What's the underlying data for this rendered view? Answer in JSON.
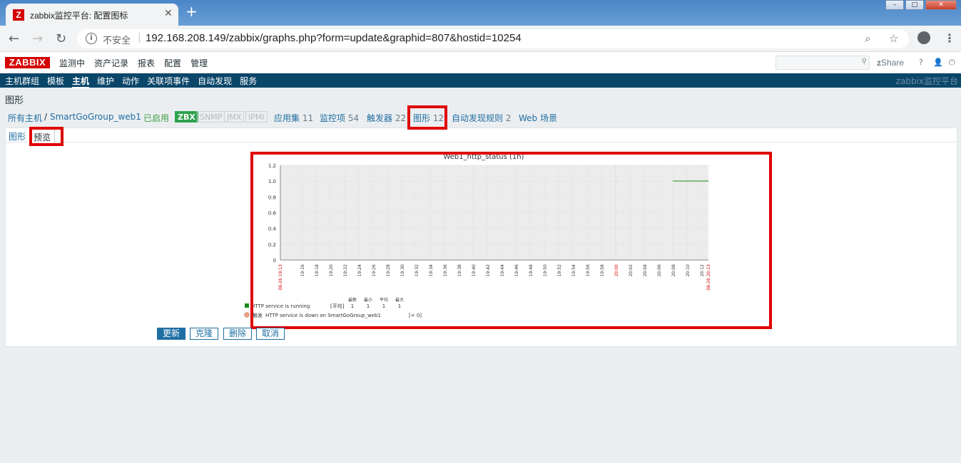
{
  "browser": {
    "tab_title": "zabbix监控平台: 配置图标",
    "tab_favicon": "Z",
    "security_label": "不安全",
    "url": "192.168.208.149/zabbix/graphs.php?form=update&graphid=807&hostid=10254"
  },
  "header": {
    "logo": "ZABBIX",
    "menu": [
      "监测中",
      "资产记录",
      "报表",
      "配置",
      "管理"
    ],
    "share_label": "Share",
    "help_label": "?"
  },
  "submenu": {
    "items": [
      "主机群组",
      "模板",
      "主机",
      "维护",
      "动作",
      "关联项事件",
      "自动发现",
      "服务"
    ],
    "active_index": 2,
    "right_label": "zabbix监控平台"
  },
  "page_title": "图形",
  "hostbar": {
    "breadcrumb_all": "所有主机",
    "breadcrumb_sep": "/",
    "host_name": "SmartGoGroup_web1",
    "status": "已启用",
    "interfaces": [
      "ZBX",
      "SNMP",
      "JMX",
      "IPMI"
    ],
    "links": [
      {
        "label": "应用集",
        "count": "11"
      },
      {
        "label": "监控项",
        "count": "54"
      },
      {
        "label": "触发器",
        "count": "22"
      },
      {
        "label": "图形",
        "count": "12"
      },
      {
        "label": "自动发现规则",
        "count": "2"
      },
      {
        "label": "Web 场景",
        "count": ""
      }
    ]
  },
  "subtabs": [
    "图形",
    "预览"
  ],
  "buttons": {
    "update": "更新",
    "clone": "克隆",
    "delete": "删除",
    "cancel": "取消"
  },
  "chart_data": {
    "type": "line",
    "title": "Web1_http_status (1h)",
    "ylim": [
      0,
      1.2
    ],
    "y_ticks": [
      "1.2",
      "1.0",
      "0.8",
      "0.6",
      "0.4",
      "0.2",
      "0"
    ],
    "x_start_label": "08-26 19:13",
    "x_end_label": "08-26 20:13",
    "x_ticks": [
      "19:16",
      "19:18",
      "19:20",
      "19:22",
      "19:24",
      "19:26",
      "19:28",
      "19:30",
      "19:32",
      "19:34",
      "19:36",
      "19:38",
      "19:40",
      "19:42",
      "19:44",
      "19:46",
      "19:48",
      "19:50",
      "19:52",
      "19:54",
      "19:56",
      "19:58",
      "20:00",
      "20:02",
      "20:04",
      "20:06",
      "20:08",
      "20:10",
      "20:12"
    ],
    "x_highlight_tick": "20:00",
    "series": [
      {
        "name": "HTTP service is running",
        "color": "#1a8a1a",
        "x": [
          "20:08",
          "20:13"
        ],
        "values": [
          1,
          1
        ],
        "last": "1",
        "min": "1",
        "avg": "1",
        "max": "1",
        "func": "[平均]"
      }
    ],
    "stat_headers": [
      "最新",
      "最小",
      "平均",
      "最大"
    ],
    "trigger": {
      "label": "HTTP service is down on SmartGoGroup_web1",
      "condition": "[= 0]",
      "prefix": "触发",
      "color": "#f4a07a"
    }
  }
}
